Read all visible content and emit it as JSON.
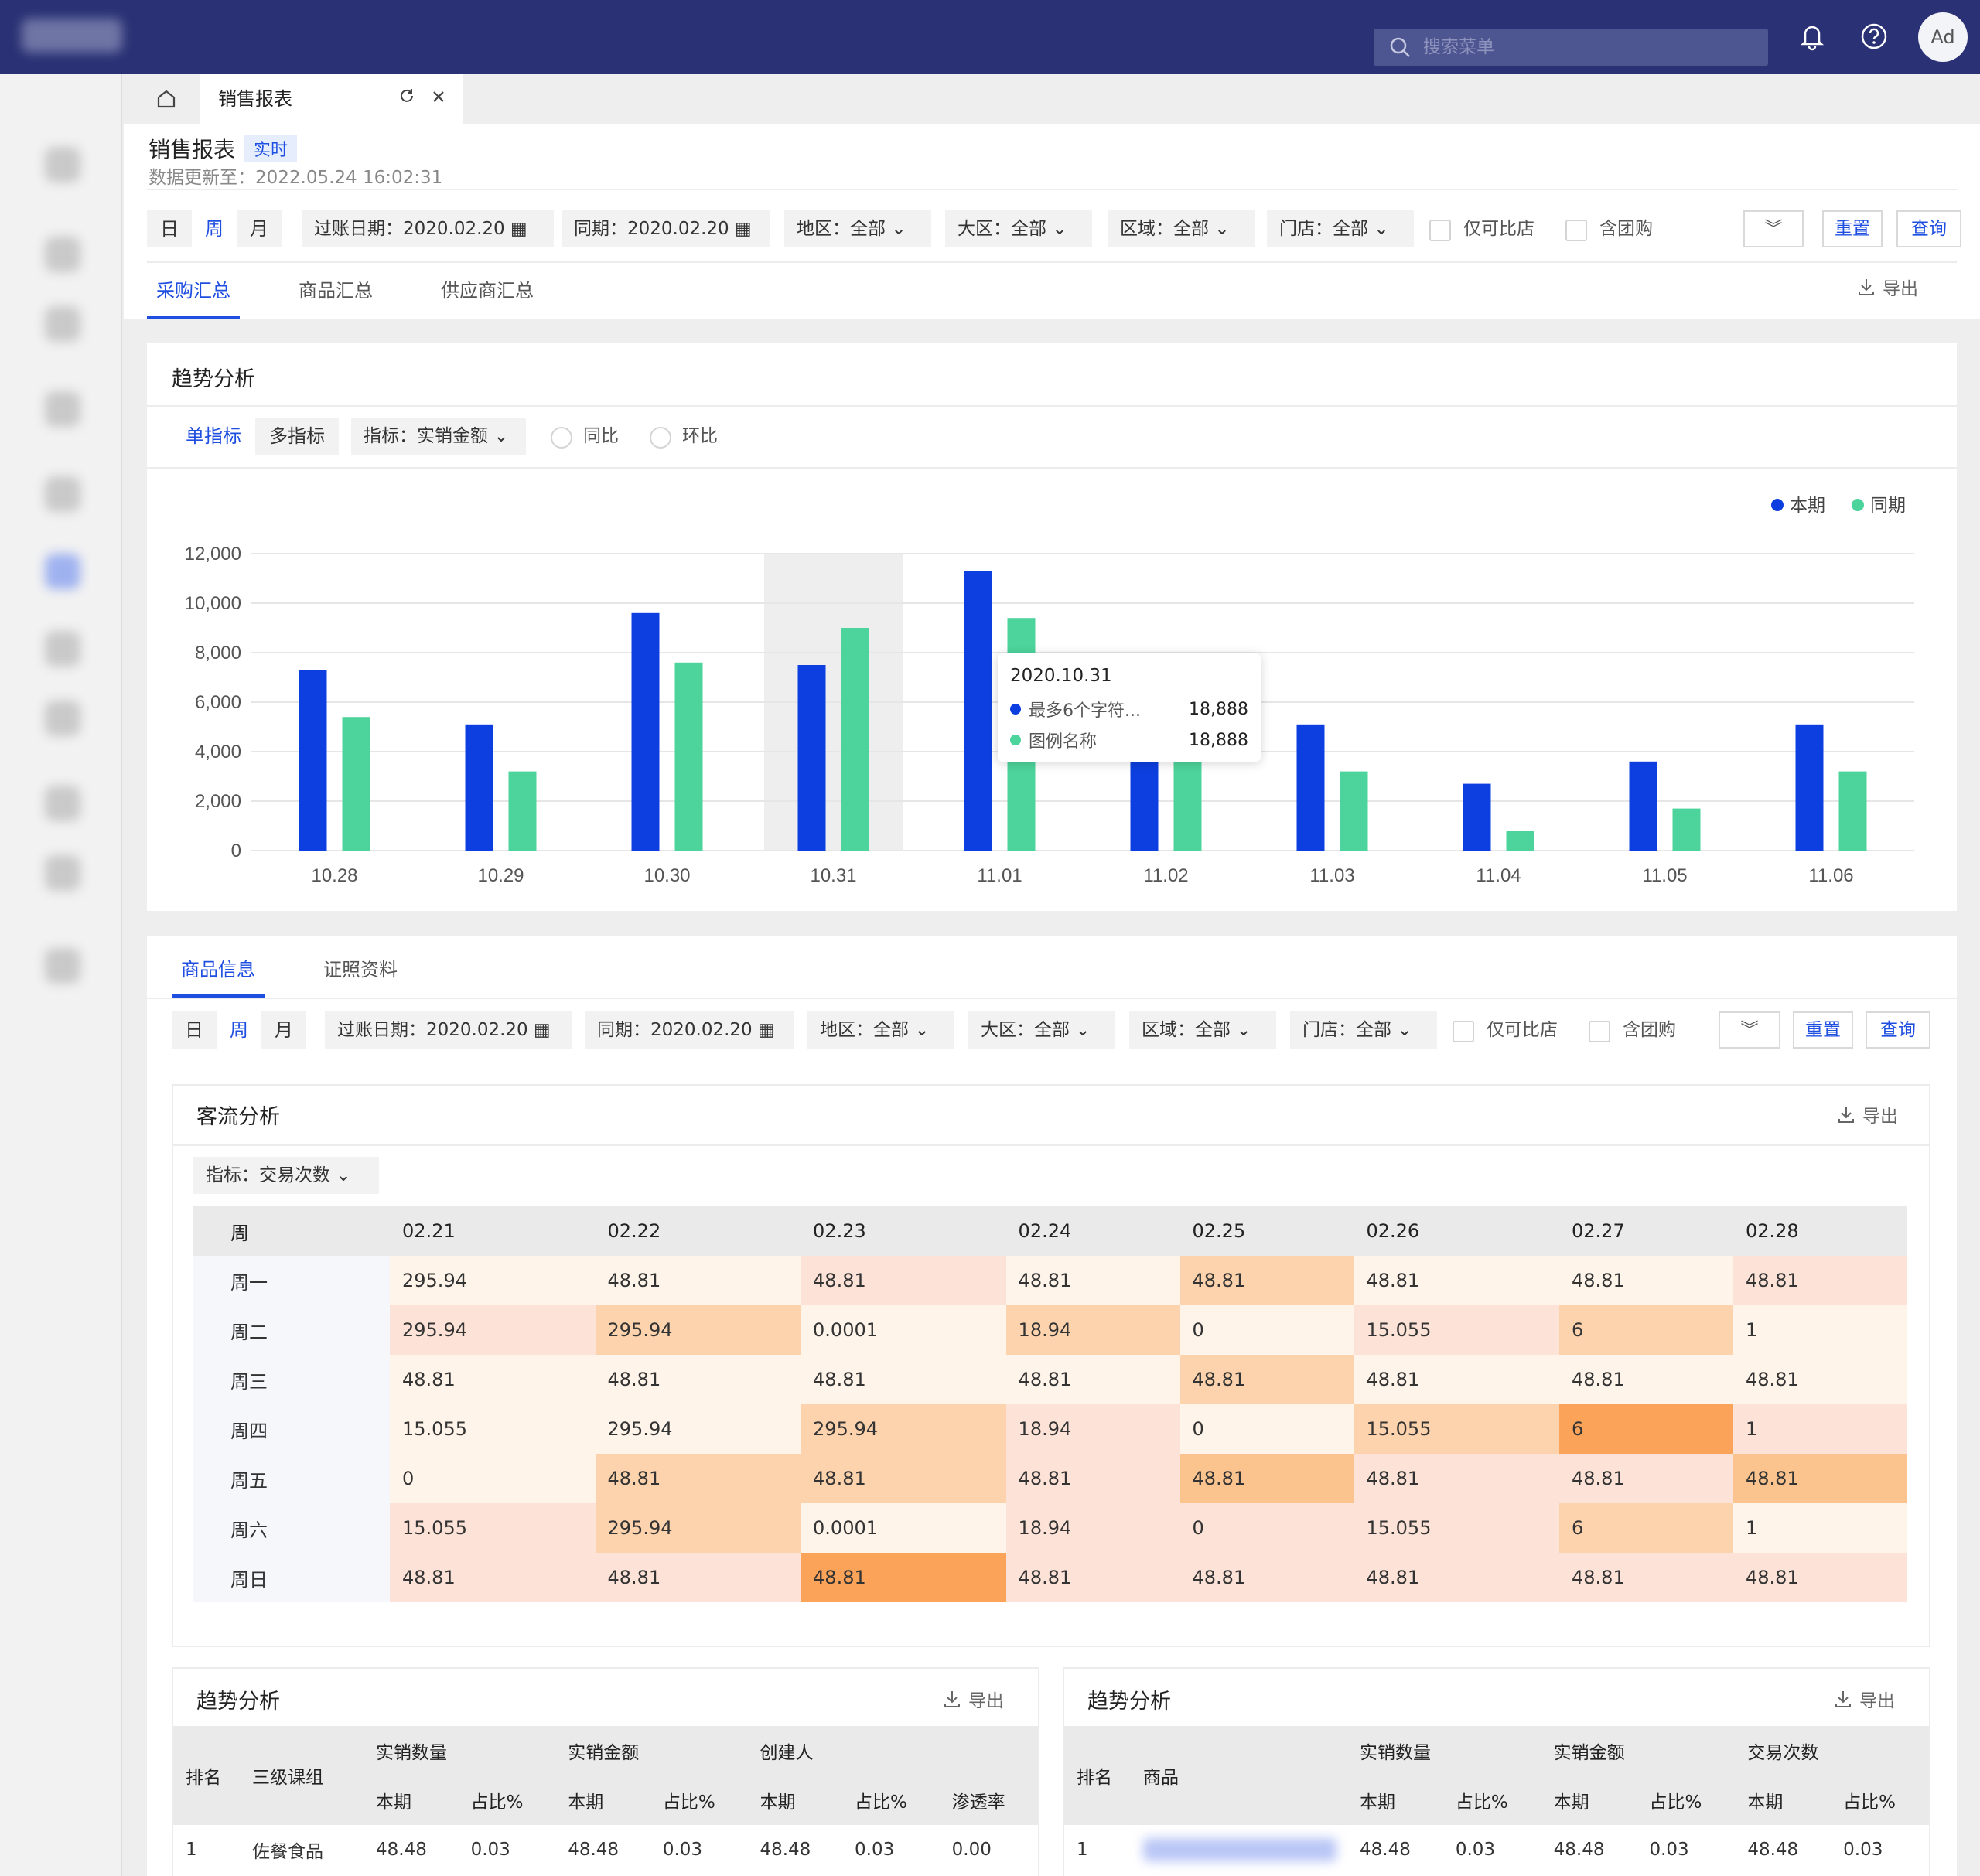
{
  "topbar": {
    "search_placeholder": "搜索菜单",
    "avatar": "Ad",
    "icons": [
      "bell-icon",
      "help-icon"
    ]
  },
  "tabbar": {
    "active_tab": "销售报表"
  },
  "page": {
    "title": "销售报表",
    "badge": "实时",
    "updated": "数据更新至：2022.05.24 16:02:31"
  },
  "filters": {
    "period": [
      "日",
      "周",
      "月"
    ],
    "active_period": "周",
    "posting_date": "过账日期：2020.02.20",
    "same_period": "同期：2020.02.20",
    "region": "地区：全部",
    "area": "大区：全部",
    "zone": "区域：全部",
    "store": "门店：全部",
    "comparable": "仅可比店",
    "group_buy": "含团购",
    "reset": "重置",
    "query": "查询"
  },
  "main_tabs": [
    "采购汇总",
    "商品汇总",
    "供应商汇总"
  ],
  "export": "导出",
  "trend": {
    "title": "趋势分析",
    "mode_single": "单指标",
    "mode_multi": "多指标",
    "metric": "指标：实销金额",
    "yoy": "同比",
    "mom": "环比"
  },
  "chart_data": {
    "type": "bar",
    "categories": [
      "10.28",
      "10.29",
      "10.30",
      "10.31",
      "11.01",
      "11.02",
      "11.03",
      "11.04",
      "11.05",
      "11.06"
    ],
    "series": [
      {
        "name": "本期",
        "color": "#0d3fe0",
        "values": [
          7300,
          5100,
          9600,
          7500,
          11300,
          5600,
          5100,
          2700,
          3600,
          5100
        ]
      },
      {
        "name": "同期",
        "color": "#4dd49c",
        "values": [
          5400,
          3200,
          7600,
          9000,
          9400,
          4800,
          3200,
          800,
          1700,
          3200
        ]
      }
    ],
    "ylim": [
      0,
      12000
    ],
    "yticks": [
      "12,000",
      "10,000",
      "8,000",
      "6,000",
      "4,000",
      "2,000",
      "0"
    ],
    "highlight_category": "10.31",
    "legend_position": "top-right",
    "grid": true,
    "tooltip": {
      "title": "2020.10.31",
      "rows": [
        {
          "label": "最多6个字符...",
          "value": "18,888",
          "color": "#0d3fe0"
        },
        {
          "label": "图例名称",
          "value": "18,888",
          "color": "#4dd49c"
        }
      ]
    }
  },
  "info_tabs": [
    "商品信息",
    "证照资料"
  ],
  "traffic": {
    "title": "客流分析",
    "metric": "指标：交易次数",
    "columns": [
      "周",
      "02.21",
      "02.22",
      "02.23",
      "02.24",
      "02.25",
      "02.26",
      "02.27",
      "02.28"
    ],
    "rows": [
      {
        "label": "周一",
        "cells": [
          "295.94",
          "48.81",
          "48.81",
          "48.81",
          "48.81",
          "48.81",
          "48.81",
          "48.81"
        ],
        "levels": [
          1,
          1,
          2,
          1,
          3,
          1,
          1,
          2
        ]
      },
      {
        "label": "周二",
        "cells": [
          "295.94",
          "295.94",
          "0.0001",
          "18.94",
          "0",
          "15.055",
          "6",
          "1"
        ],
        "levels": [
          2,
          3,
          1,
          3,
          1,
          2,
          3,
          1
        ]
      },
      {
        "label": "周三",
        "cells": [
          "48.81",
          "48.81",
          "48.81",
          "48.81",
          "48.81",
          "48.81",
          "48.81",
          "48.81"
        ],
        "levels": [
          1,
          1,
          1,
          1,
          3,
          1,
          1,
          1
        ]
      },
      {
        "label": "周四",
        "cells": [
          "15.055",
          "295.94",
          "295.94",
          "18.94",
          "0",
          "15.055",
          "6",
          "1"
        ],
        "levels": [
          1,
          1,
          3,
          2,
          1,
          3,
          5,
          2
        ]
      },
      {
        "label": "周五",
        "cells": [
          "0",
          "48.81",
          "48.81",
          "48.81",
          "48.81",
          "48.81",
          "48.81",
          "48.81"
        ],
        "levels": [
          1,
          3,
          3,
          2,
          4,
          2,
          2,
          4
        ]
      },
      {
        "label": "周六",
        "cells": [
          "15.055",
          "295.94",
          "0.0001",
          "18.94",
          "0",
          "15.055",
          "6",
          "1"
        ],
        "levels": [
          2,
          3,
          1,
          2,
          2,
          2,
          3,
          1
        ]
      },
      {
        "label": "周日",
        "cells": [
          "48.81",
          "48.81",
          "48.81",
          "48.81",
          "48.81",
          "48.81",
          "48.81",
          "48.81"
        ],
        "levels": [
          2,
          2,
          5,
          2,
          2,
          2,
          2,
          2
        ]
      }
    ]
  },
  "table_left": {
    "title": "趋势分析",
    "h1": [
      "排名",
      "三级课组",
      "实销数量",
      "实销金额",
      "创建人"
    ],
    "h2": [
      "本期",
      "占比%",
      "本期",
      "占比%",
      "本期",
      "占比%",
      "渗透率"
    ],
    "rows": [
      [
        "1",
        "佐餐食品",
        "48.48",
        "0.03",
        "48.48",
        "0.03",
        "48.48",
        "0.03",
        "0.00"
      ]
    ]
  },
  "table_right": {
    "title": "趋势分析",
    "h1": [
      "排名",
      "商品",
      "实销数量",
      "实销金额",
      "交易次数"
    ],
    "h2": [
      "本期",
      "占比%",
      "本期",
      "占比%",
      "本期",
      "占比%"
    ],
    "rows": [
      [
        "1",
        "",
        "48.48",
        "0.03",
        "48.48",
        "0.03",
        "48.48",
        "0.03"
      ]
    ]
  }
}
